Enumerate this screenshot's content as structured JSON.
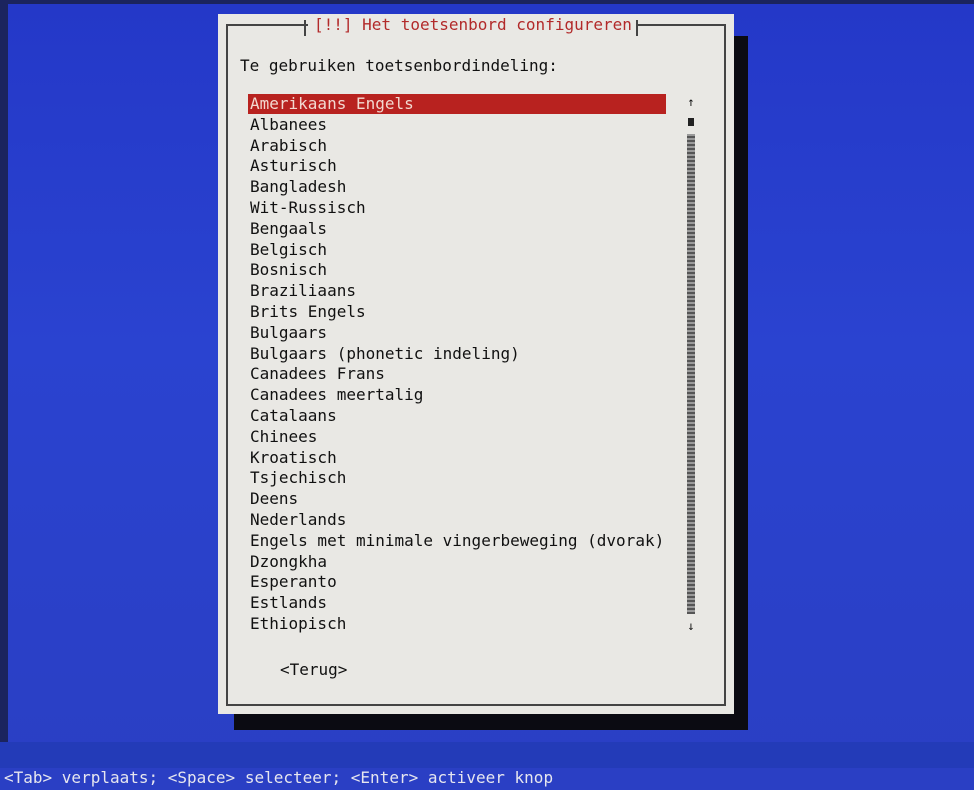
{
  "dialog": {
    "title": "[!!] Het toetsenbord configureren",
    "prompt": "Te gebruiken toetsenbordindeling:",
    "back_button": "<Terug>"
  },
  "layouts": [
    {
      "label": "Amerikaans Engels",
      "selected": true
    },
    {
      "label": "Albanees"
    },
    {
      "label": "Arabisch"
    },
    {
      "label": "Asturisch"
    },
    {
      "label": "Bangladesh"
    },
    {
      "label": "Wit-Russisch"
    },
    {
      "label": "Bengaals"
    },
    {
      "label": "Belgisch"
    },
    {
      "label": "Bosnisch"
    },
    {
      "label": "Braziliaans"
    },
    {
      "label": "Brits Engels"
    },
    {
      "label": "Bulgaars"
    },
    {
      "label": "Bulgaars (phonetic indeling)"
    },
    {
      "label": "Canadees Frans"
    },
    {
      "label": "Canadees meertalig"
    },
    {
      "label": "Catalaans"
    },
    {
      "label": "Chinees"
    },
    {
      "label": "Kroatisch"
    },
    {
      "label": "Tsjechisch"
    },
    {
      "label": "Deens"
    },
    {
      "label": "Nederlands"
    },
    {
      "label": "Engels met minimale vingerbeweging (dvorak)"
    },
    {
      "label": "Dzongkha"
    },
    {
      "label": "Esperanto"
    },
    {
      "label": "Estlands"
    },
    {
      "label": "Ethiopisch"
    }
  ],
  "scrollbar": {
    "up_icon": "arrow-up-icon",
    "down_icon": "arrow-down-icon",
    "up_glyph": "↑",
    "down_glyph": "↓"
  },
  "status_bar": {
    "text": "<Tab> verplaats; <Space> selecteer; <Enter> activeer knop"
  },
  "colors": {
    "background": "#2a3fc4",
    "dialog": "#e9e8e4",
    "title": "#b22a2a",
    "selection": "#b8221f"
  }
}
